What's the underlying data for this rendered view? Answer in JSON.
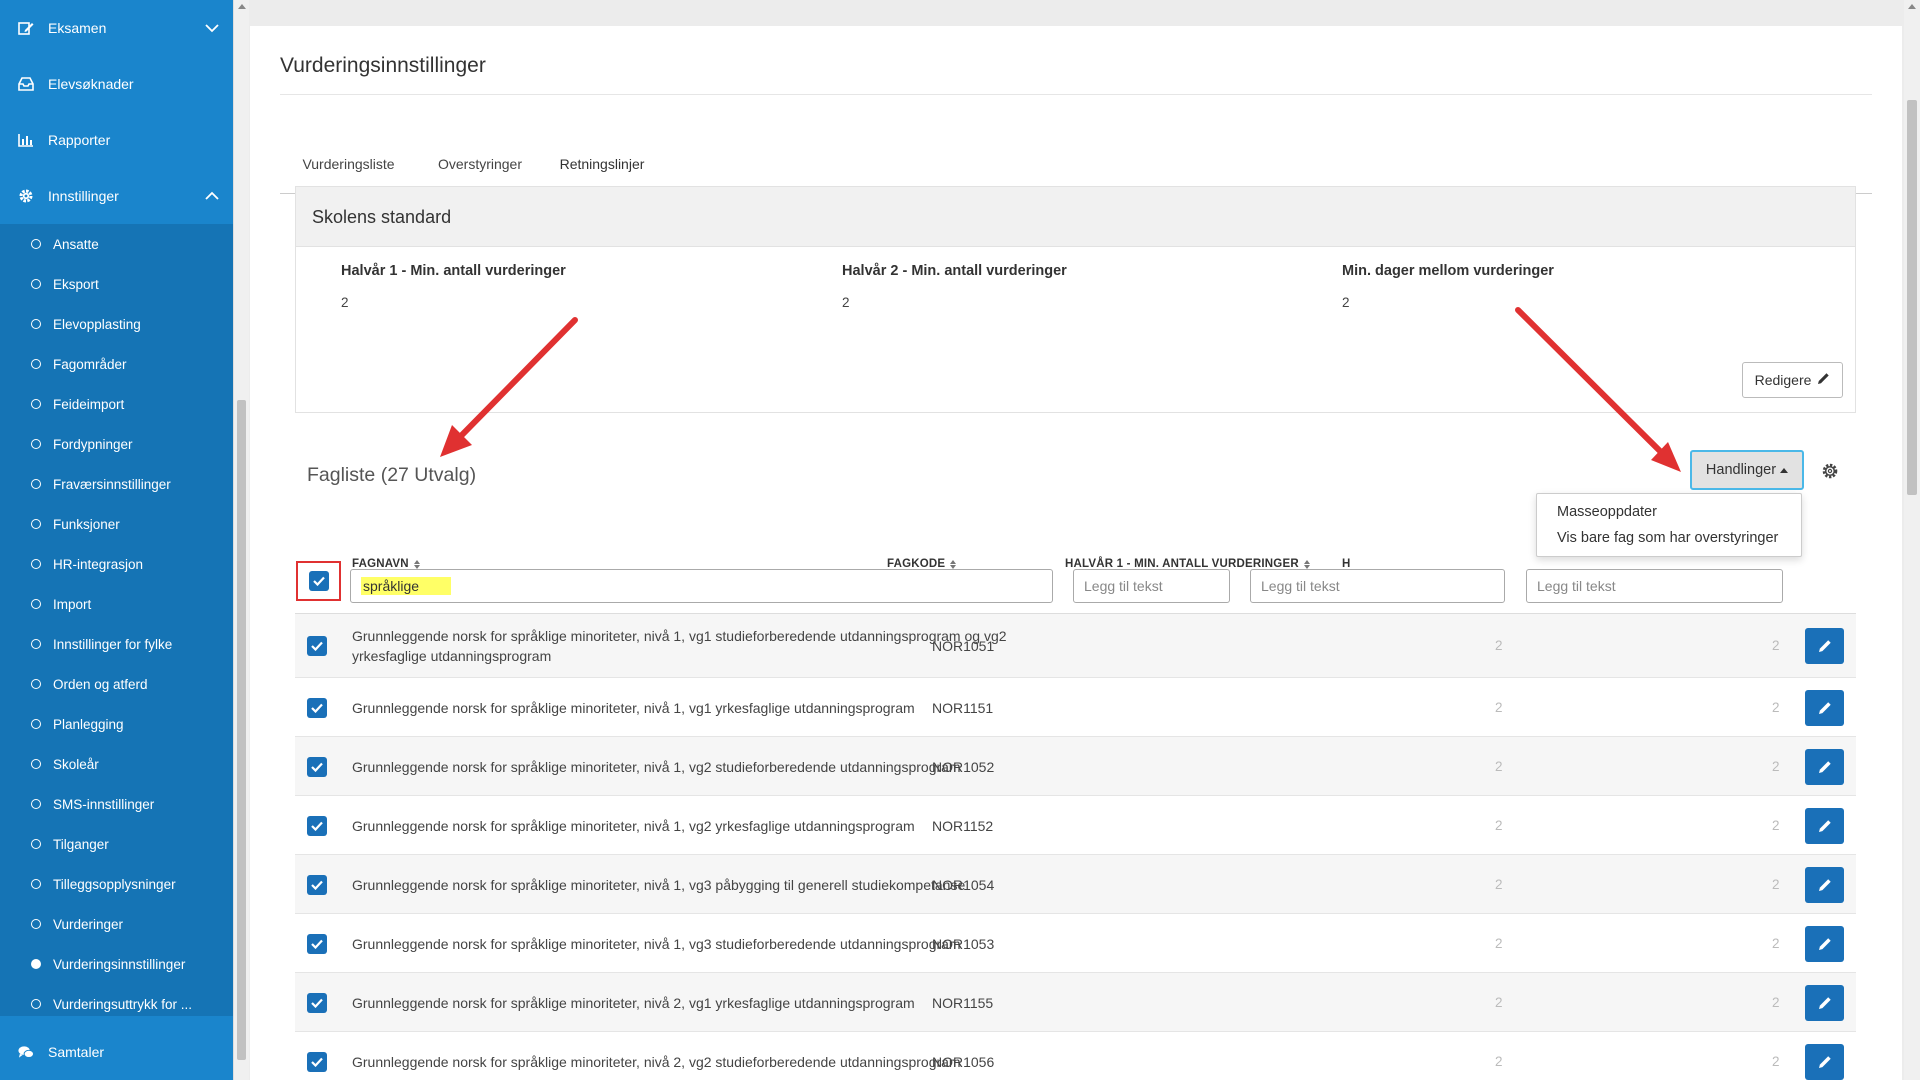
{
  "sidebar": {
    "main_items": [
      {
        "label": "Eksamen",
        "icon": "edit-icon"
      },
      {
        "label": "Elevsøknader",
        "icon": "inbox-icon"
      },
      {
        "label": "Rapporter",
        "icon": "bar-chart-icon"
      },
      {
        "label": "Innstillinger",
        "icon": "gear-icon"
      }
    ],
    "sub_items": [
      "Ansatte",
      "Eksport",
      "Elevopplasting",
      "Fagområder",
      "Feideimport",
      "Fordypninger",
      "Fraværsinnstillinger",
      "Funksjoner",
      "HR-integrasjon",
      "Import",
      "Innstillinger for fylke",
      "Orden og atferd",
      "Planlegging",
      "Skoleår",
      "SMS-innstillinger",
      "Tilganger",
      "Tilleggsopplysninger",
      "Vurderinger",
      "Vurderingsinnstillinger",
      "Vurderingsuttrykk for ..."
    ],
    "active_sub": "Vurderingsinnstillinger",
    "bottom_item": {
      "label": "Samtaler",
      "icon": "chat-icon"
    }
  },
  "page": {
    "title": "Vurderingsinnstillinger",
    "tabs": [
      "Vurderingsliste",
      "Overstyringer",
      "Retningslinjer"
    ],
    "active_tab": "Retningslinjer"
  },
  "school_standard": {
    "heading": "Skolens standard",
    "stats": [
      {
        "label": "Halvår 1 - Min. antall vurderinger",
        "value": "2"
      },
      {
        "label": "Halvår 2 - Min. antall vurderinger",
        "value": "2"
      },
      {
        "label": "Min. dager mellom vurderinger",
        "value": "2"
      }
    ],
    "edit_label": "Redigere"
  },
  "subject_list": {
    "title": "Fagliste (27 Utvalg)",
    "actions_label": "Handlinger",
    "dropdown": [
      "Masseoppdater",
      "Vis bare fag som har overstyringer"
    ],
    "columns": {
      "name": "FAGNAVN",
      "code": "FAGKODE",
      "h1": "HALVÅR 1 - MIN. ANTALL VURDERINGER",
      "h2": "H"
    },
    "search_value": "språklige",
    "filter_placeholder": "Legg til tekst",
    "rows": [
      {
        "name": "Grunnleggende norsk for språklige minoriteter, nivå 1, vg1 studieforberedende utdanningsprogram og vg2 yrkesfaglige utdanningsprogram",
        "code": "NOR1051",
        "h1": "2",
        "h2": "2"
      },
      {
        "name": "Grunnleggende norsk for språklige minoriteter, nivå 1, vg1 yrkesfaglige utdanningsprogram",
        "code": "NOR1151",
        "h1": "2",
        "h2": "2"
      },
      {
        "name": "Grunnleggende norsk for språklige minoriteter, nivå 1, vg2 studieforberedende utdanningsprogram",
        "code": "NOR1052",
        "h1": "2",
        "h2": "2"
      },
      {
        "name": "Grunnleggende norsk for språklige minoriteter, nivå 1, vg2 yrkesfaglige utdanningsprogram",
        "code": "NOR1152",
        "h1": "2",
        "h2": "2"
      },
      {
        "name": "Grunnleggende norsk for språklige minoriteter, nivå 1, vg3 påbygging til generell studiekompetanse",
        "code": "NOR1054",
        "h1": "2",
        "h2": "2"
      },
      {
        "name": "Grunnleggende norsk for språklige minoriteter, nivå 1, vg3 studieforberedende utdanningsprogram",
        "code": "NOR1053",
        "h1": "2",
        "h2": "2"
      },
      {
        "name": "Grunnleggende norsk for språklige minoriteter, nivå 2, vg1 yrkesfaglige utdanningsprogram",
        "code": "NOR1155",
        "h1": "2",
        "h2": "2"
      },
      {
        "name": "Grunnleggende norsk for språklige minoriteter, nivå 2, vg2 studieforberedende utdanningsprogram",
        "code": "NOR1056",
        "h1": "2",
        "h2": "2"
      }
    ]
  },
  "colors": {
    "sidebar": "#1a85cc",
    "sidebar_sub": "#1574b5",
    "primary": "#1a70b8",
    "annotation_red": "#e03131",
    "highlight_yellow": "#ffff66"
  }
}
